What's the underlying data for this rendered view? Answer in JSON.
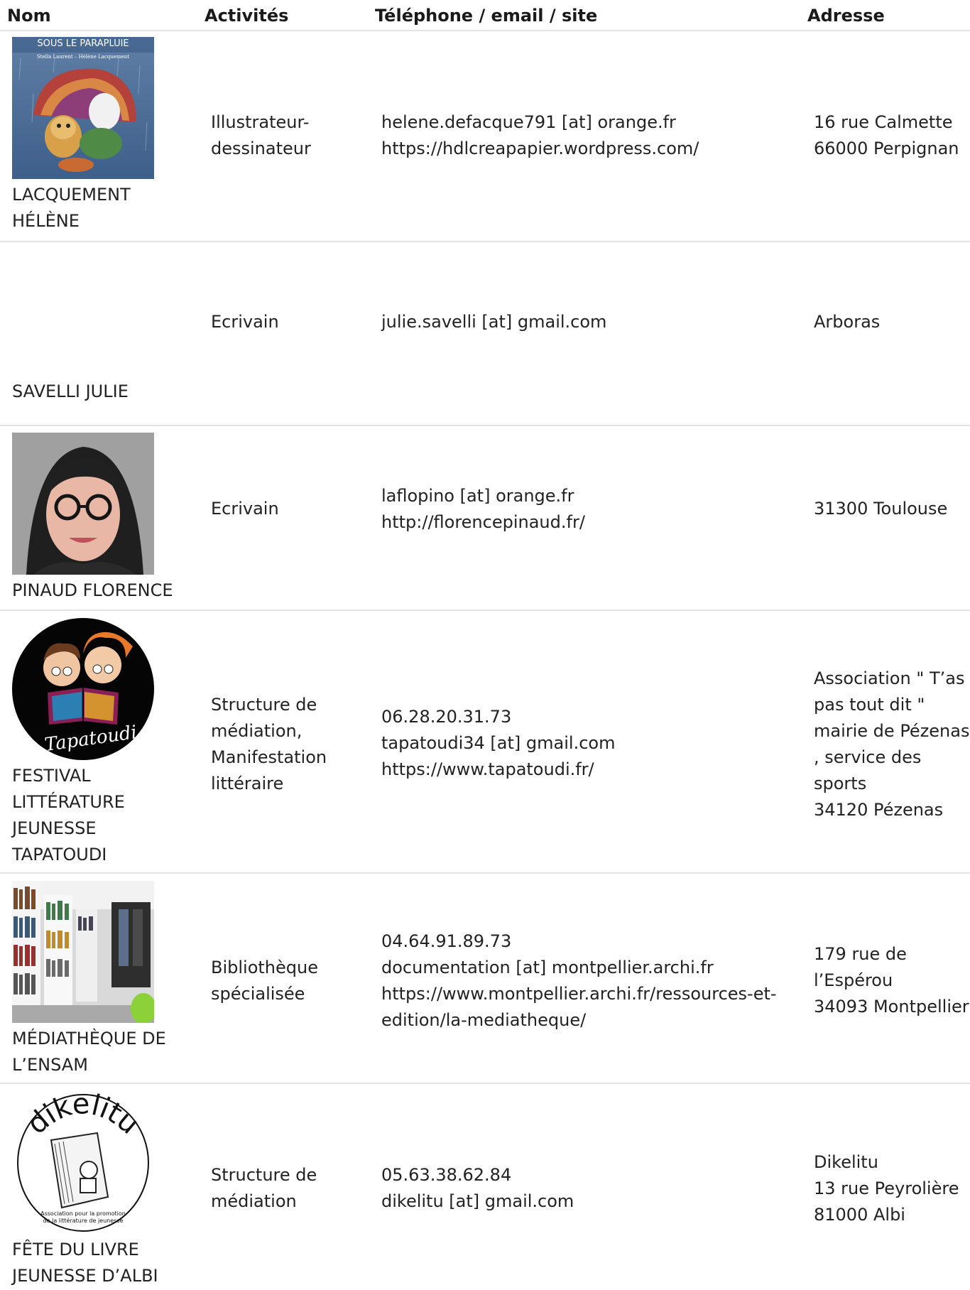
{
  "headers": {
    "nom": "Nom",
    "activites": "Activités",
    "contact": "Téléphone / email / site",
    "adresse": "Adresse"
  },
  "rows": [
    {
      "name": "LACQUEMENT\nHÉLÈNE",
      "activity": "Illustrateur-\ndessinateur",
      "contact": "helene.defacque791 [at] orange.fr\nhttps://hdlcreapapier.wordpress.com/",
      "address": "16 rue Calmette\n66000 Perpignan",
      "image_title": "SOUS LE PARAPLUIE",
      "image_subtitle": "Stella Laurent – Hélène Lacquement"
    },
    {
      "name": "SAVELLI JULIE",
      "activity": "Ecrivain",
      "contact": "julie.savelli [at] gmail.com",
      "address": "Arboras"
    },
    {
      "name": "PINAUD FLORENCE",
      "activity": "Ecrivain",
      "contact": "laflopino [at] orange.fr\nhttp://florencepinaud.fr/",
      "address": "31300 Toulouse"
    },
    {
      "name": "FESTIVAL\nLITTÉRATURE\nJEUNESSE\nTAPATOUDI",
      "activity": "Structure de\nmédiation,\nManifestation\nlittéraire",
      "contact": "06.28.20.31.73\ntapatoudi34 [at] gmail.com\nhttps://www.tapatoudi.fr/",
      "address": "Association \" T’as\npas tout dit \"\nmairie de Pézenas\n, service des\nsports\n34120 Pézenas",
      "image_logo_text": "Tapatoudi"
    },
    {
      "name": "MÉDIATHÈQUE DE\nL’ENSAM",
      "activity": "Bibliothèque\nspécialisée",
      "contact": "04.64.91.89.73\ndocumentation [at] montpellier.archi.fr\nhttps://www.montpellier.archi.fr/ressources-et-\nedition/la-mediatheque/",
      "address": "179 rue de\nl’Espérou\n34093 Montpellier"
    },
    {
      "name": "FÊTE DU LIVRE\nJEUNESSE D’ALBI",
      "activity": "Structure de\nmédiation",
      "contact": "05.63.38.62.84\ndikelitu [at] gmail.com",
      "address": "Dikelitu\n13 rue Peyrolière\n81000 Albi",
      "image_logo_text": "dikelitu",
      "image_caption": "Association pour la promotion\nde la littérature de jeunesse"
    }
  ]
}
